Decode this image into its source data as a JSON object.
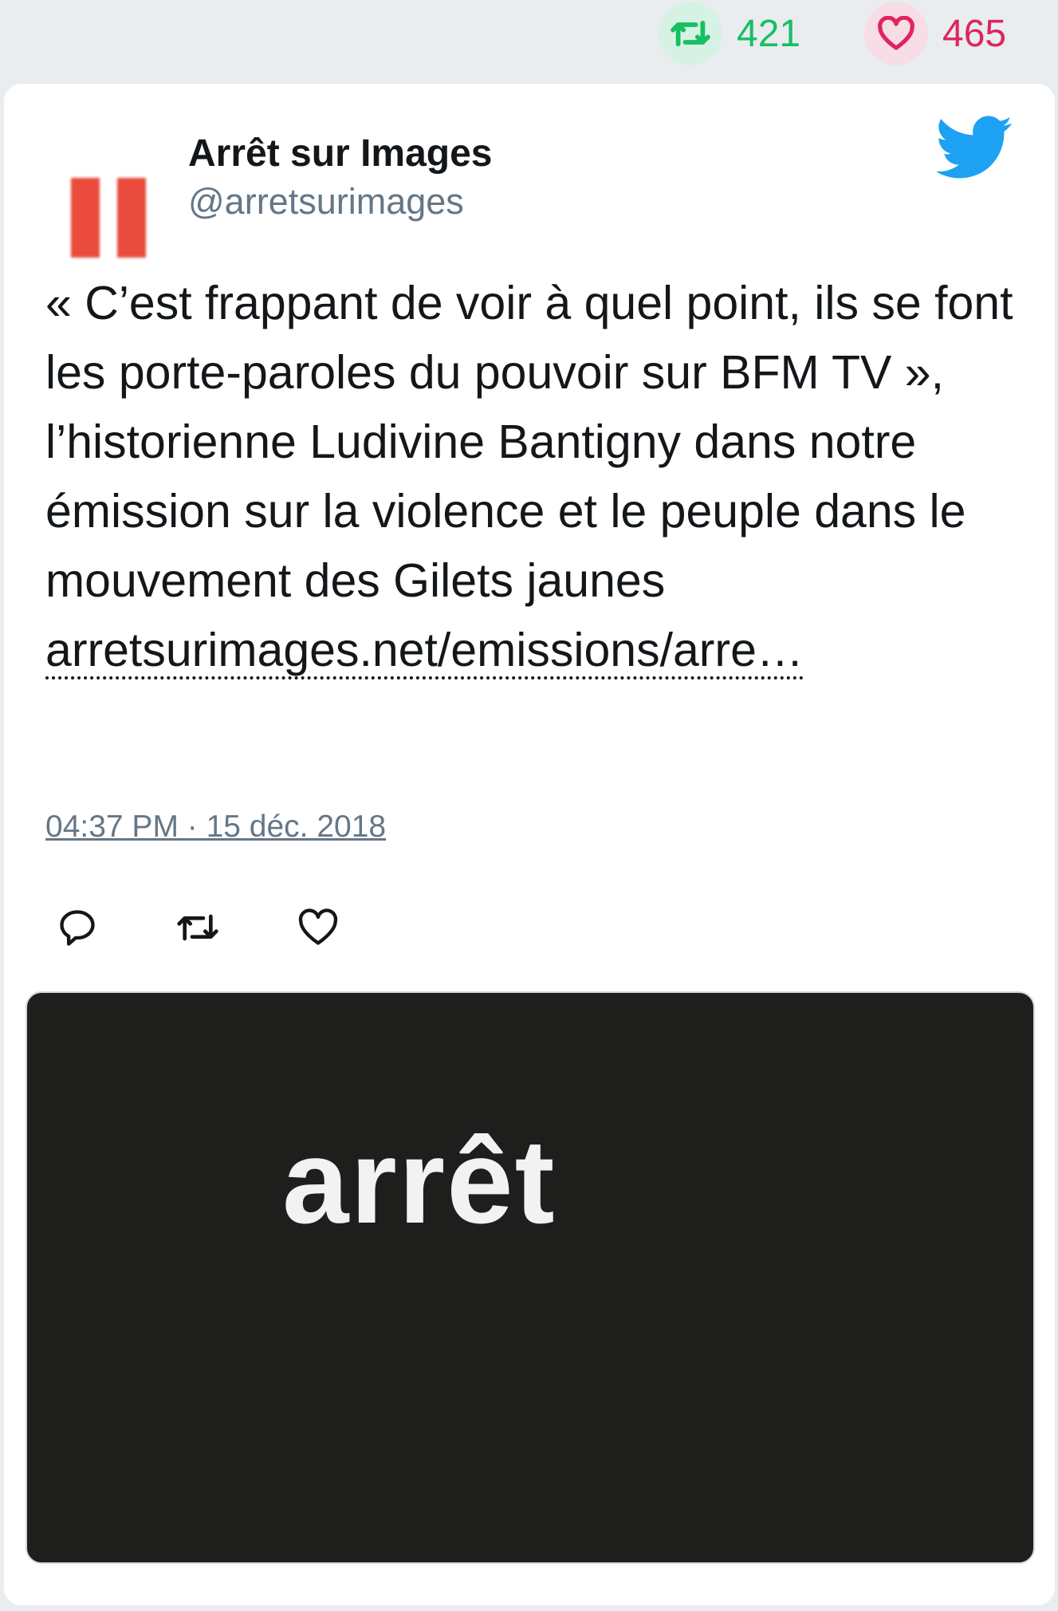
{
  "stats": {
    "retweets": "421",
    "likes": "465"
  },
  "tweet": {
    "author_name": "Arrêt sur Images",
    "author_handle": "@arretsurimages",
    "text": "« C’est frappant de voir à quel point, ils se font les porte-paroles du pouvoir sur BFM TV », l’historienne Ludivine Bantigny dans notre émission sur la violence et le peuple dans le mouvement des Gilets jaunes",
    "link": "arretsurimages.net/emissions/arre…",
    "timestamp": "04:37 PM · 15 déc. 2018"
  },
  "media": {
    "logo_text": "arrêt"
  },
  "icons": {
    "retweet": "retweet-icon",
    "like": "heart-icon",
    "reply": "reply-icon",
    "brand": "twitter-bird-icon"
  },
  "colors": {
    "retweet": "#17bf63",
    "like": "#e0245e",
    "twitter_blue": "#1da1f2",
    "avatar_red": "#ea4b3c"
  }
}
